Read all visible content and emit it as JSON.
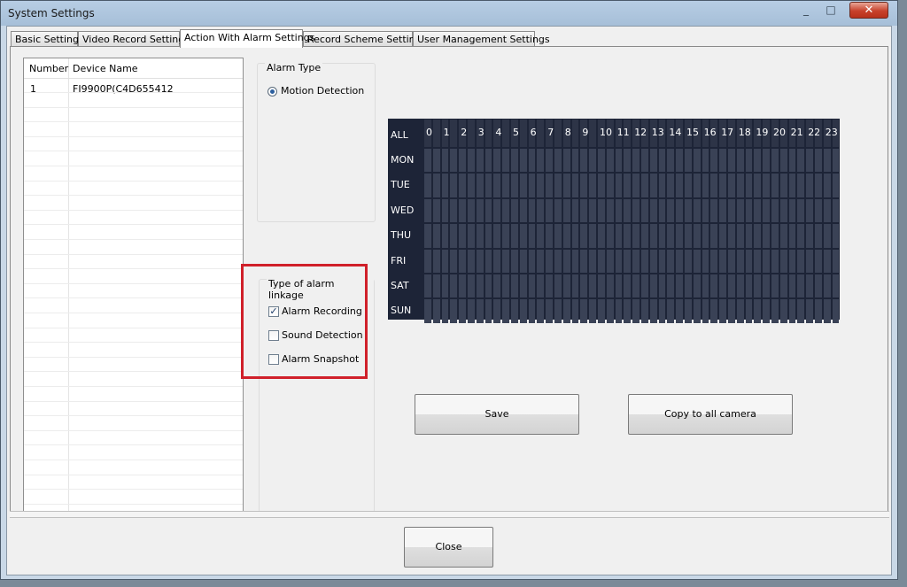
{
  "window": {
    "title": "System Settings",
    "close_glyph": "✕",
    "minimize_glyph": "_",
    "maximize_glyph": "□"
  },
  "tabs": [
    {
      "label": "Basic Settings",
      "active": false
    },
    {
      "label": "Video Record Settings",
      "active": false
    },
    {
      "label": "Action With Alarm Settings",
      "active": true
    },
    {
      "label": "Record Scheme Settings",
      "active": false
    },
    {
      "label": "User Management Settings",
      "active": false
    }
  ],
  "device_list": {
    "columns": [
      "Number",
      "Device Name"
    ],
    "rows": [
      {
        "number": "1",
        "name": "FI9900P(C4D655412"
      }
    ]
  },
  "alarm_type": {
    "legend": "Alarm Type",
    "options": [
      {
        "label": "Motion Detection",
        "selected": true
      }
    ]
  },
  "alarm_linkage": {
    "legend": "Type of alarm linkage",
    "options": [
      {
        "label": "Alarm Recording",
        "checked": true
      },
      {
        "label": "Sound Detection",
        "checked": false
      },
      {
        "label": "Alarm Snapshot",
        "checked": false
      }
    ]
  },
  "schedule": {
    "all_label": "ALL",
    "hours": [
      "0",
      "1",
      "2",
      "3",
      "4",
      "5",
      "6",
      "7",
      "8",
      "9",
      "10",
      "11",
      "12",
      "13",
      "14",
      "15",
      "16",
      "17",
      "18",
      "19",
      "20",
      "21",
      "22",
      "23"
    ],
    "days": [
      "MON",
      "TUE",
      "WED",
      "THU",
      "FRI",
      "SAT",
      "SUN"
    ],
    "colors": {
      "background": "#1d2437",
      "cell": "#3a4256",
      "text": "#ffffff"
    }
  },
  "buttons": {
    "save": "Save",
    "copy_all": "Copy to all camera",
    "close": "Close"
  },
  "highlight": {
    "color": "#d0202a"
  }
}
